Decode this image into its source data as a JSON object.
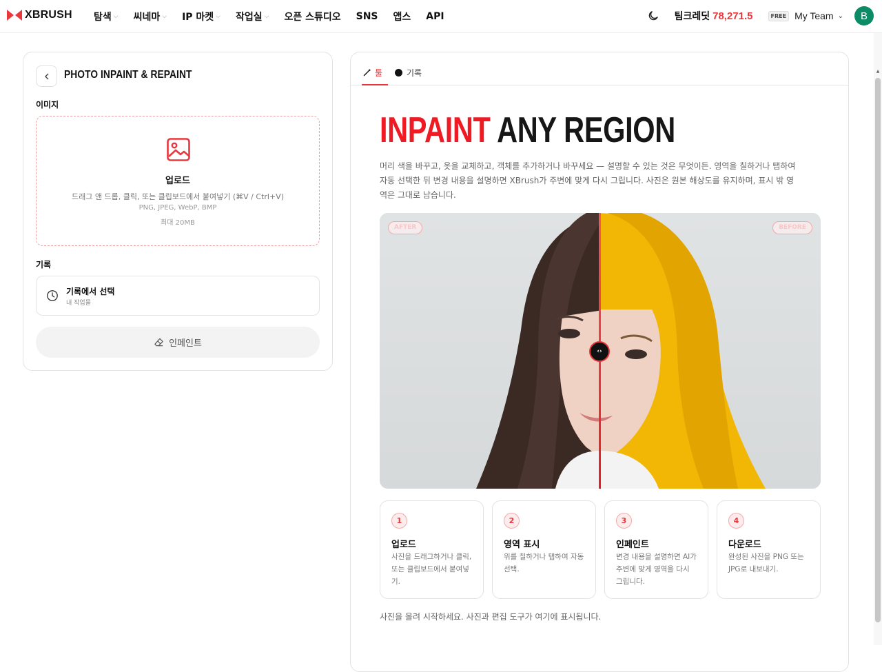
{
  "header": {
    "logo_text": "XBRUSH",
    "nav": [
      {
        "label": "탐색",
        "has_dropdown": true
      },
      {
        "label": "씨네마",
        "has_dropdown": true
      },
      {
        "label": "IP 마켓",
        "has_dropdown": true
      },
      {
        "label": "작업실",
        "has_dropdown": true
      },
      {
        "label": "오픈 스튜디오",
        "has_dropdown": false
      },
      {
        "label": "SNS",
        "has_dropdown": false
      },
      {
        "label": "앱스",
        "has_dropdown": false
      },
      {
        "label": "API",
        "has_dropdown": false
      }
    ],
    "credit_label": "팀크레딧",
    "credit_value": "78,271.5",
    "plan_badge": "FREE",
    "team_name": "My Team",
    "avatar_initial": "B"
  },
  "left_panel": {
    "title": "PHOTO INPAINT & REPAINT",
    "image_label": "이미지",
    "upload": {
      "title": "업로드",
      "description": "드래그 앤 드롭, 클릭, 또는 클립보드에서 붙여넣기 (⌘V / Ctrl+V)",
      "formats": "PNG, JPEG, WebP, BMP",
      "max_size": "최대 20MB"
    },
    "history_label": "기록",
    "history": {
      "title": "기록에서 선택",
      "subtitle": "내 작업물"
    },
    "action_button": "인페인트"
  },
  "right_panel": {
    "tabs": [
      {
        "label": "툴",
        "active": true
      },
      {
        "label": "기록",
        "active": false
      }
    ],
    "hero_red": "INPAINT",
    "hero_dark": "ANY REGION",
    "description": "머리 색을 바꾸고, 옷을 교체하고, 객체를 추가하거나 바꾸세요 — 설명할 수 있는 것은 무엇이든. 영역을 칠하거나 탭하여 자동 선택한 뒤 변경 내용을 설명하면 XBrush가 주변에 맞게 다시 그립니다. 사진은 원본 해상도를 유지하며, 표시 밖 영역은 그대로 남습니다.",
    "compare": {
      "after_label": "AFTER",
      "before_label": "BEFORE",
      "slider_position": 0.5
    },
    "steps": [
      {
        "num": "1",
        "title": "업로드",
        "desc": "사진을 드래그하거나 클릭, 또는 클립보드에서 붙여넣기."
      },
      {
        "num": "2",
        "title": "영역 표시",
        "desc": "위를 칠하거나 탭하여 자동 선택."
      },
      {
        "num": "3",
        "title": "인페인트",
        "desc": "변경 내용을 설명하면 AI가 주변에 맞게 영역을 다시 그립니다."
      },
      {
        "num": "4",
        "title": "다운로드",
        "desc": "완성된 사진을 PNG 또는 JPG로 내보내기."
      }
    ],
    "hint": "사진을 올려 시작하세요. 사진과 편집 도구가 여기에 표시됩니다."
  },
  "colors": {
    "accent": "#e8383d",
    "hero_red": "#ee1b24",
    "avatar": "#0c8b67"
  }
}
